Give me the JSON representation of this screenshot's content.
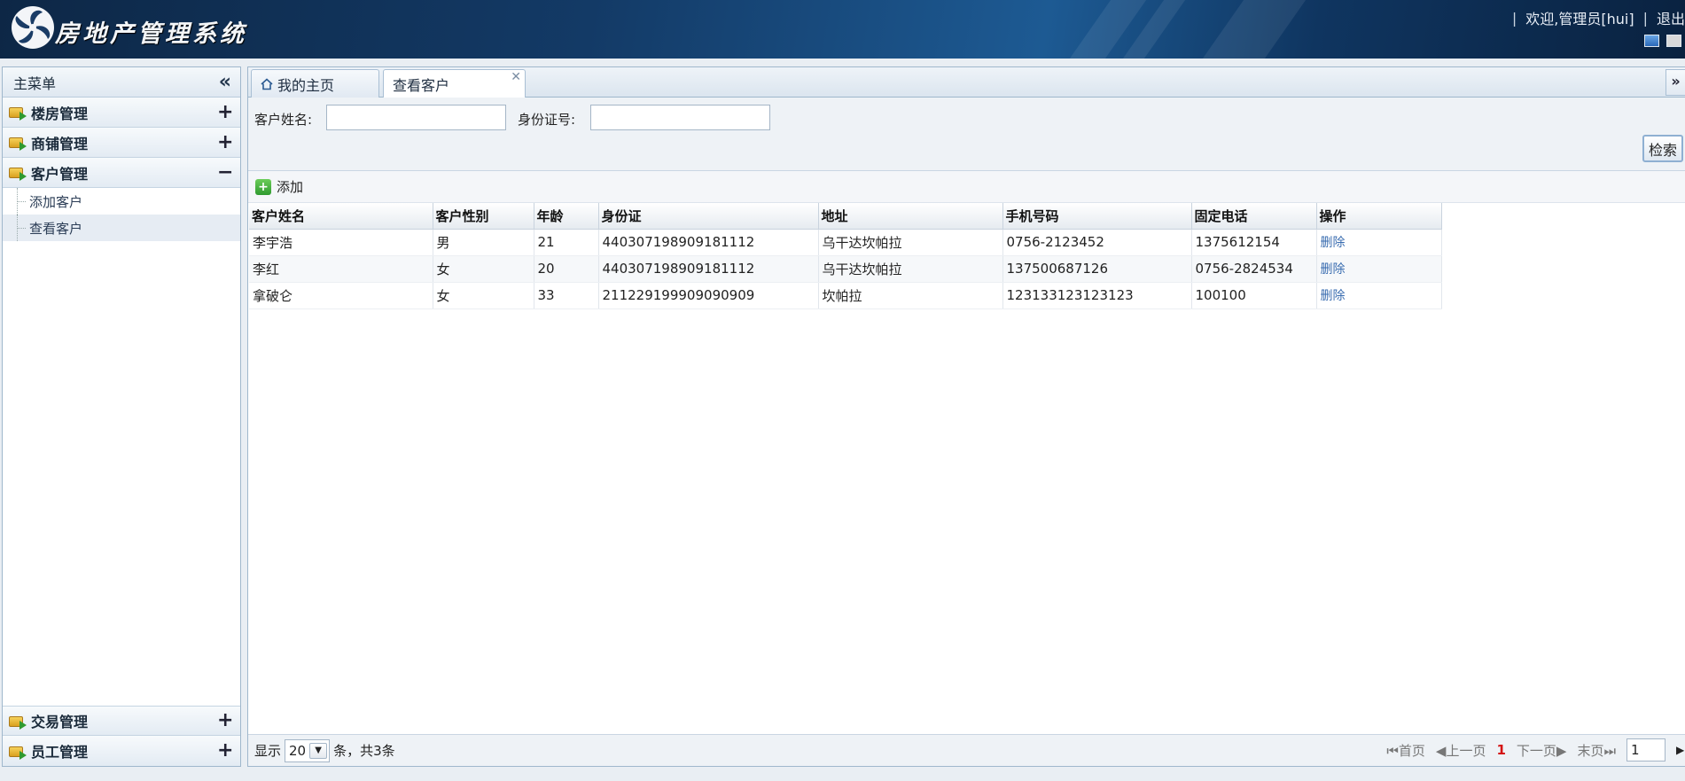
{
  "header": {
    "app_title": "房地产管理系统",
    "welcome": "欢迎,管理员[hui]",
    "logout": "退出"
  },
  "sidebar": {
    "title": "主菜单",
    "sections": [
      {
        "label": "楼房管理",
        "toggle": "+"
      },
      {
        "label": "商铺管理",
        "toggle": "+"
      },
      {
        "label": "客户管理",
        "toggle": "−",
        "items": [
          "添加客户",
          "查看客户"
        ]
      },
      {
        "label": "交易管理",
        "toggle": "+"
      },
      {
        "label": "员工管理",
        "toggle": "+"
      }
    ]
  },
  "tabs": [
    {
      "label": "我的主页"
    },
    {
      "label": "查看客户"
    }
  ],
  "search": {
    "name_label": "客户姓名:",
    "name_value": "",
    "id_label": "身份证号:",
    "id_value": "",
    "button": "检索"
  },
  "toolbar": {
    "add_label": "添加"
  },
  "table": {
    "columns": [
      "客户姓名",
      "客户性别",
      "年龄",
      "身份证",
      "地址",
      "手机号码",
      "固定电话",
      "操作"
    ],
    "rows": [
      [
        "李宇浩",
        "男",
        "21",
        "440307198909181112",
        "乌干达坎帕拉",
        "0756-2123452",
        "1375612154",
        "删除"
      ],
      [
        "李红",
        "女",
        "20",
        "440307198909181112",
        "乌干达坎帕拉",
        "137500687126",
        "0756-2824534",
        "删除"
      ],
      [
        "拿破仑",
        "女",
        "33",
        "211229199909090909",
        "坎帕拉",
        "123133123123123",
        "100100",
        "删除"
      ]
    ]
  },
  "pager": {
    "show_label": "显示",
    "page_size": "20",
    "total_text": "条，共3条",
    "first": "首页",
    "prev": "上一页",
    "current": "1",
    "next": "下一页",
    "last": "末页",
    "page_input": "1"
  },
  "colors": {
    "accent": "#1d5a93",
    "link": "#3a6db0",
    "current_page": "#d41414"
  }
}
